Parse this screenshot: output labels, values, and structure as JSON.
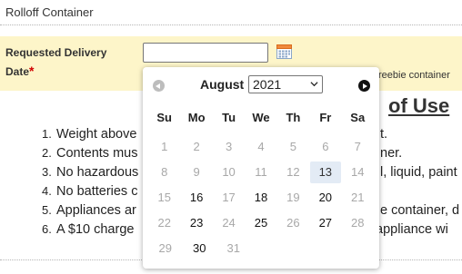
{
  "header": {
    "title": "Rolloff Container"
  },
  "delivery": {
    "label": "Requested Delivery Date",
    "required_mark": "*",
    "input_value": "",
    "side_note": "reebie container"
  },
  "terms": {
    "title": "of Use",
    "items": [
      {
        "num": "1.",
        "text": "Weight above",
        "tail": "t."
      },
      {
        "num": "2.",
        "text": "Contents mus",
        "tail": "ner."
      },
      {
        "num": "3.",
        "text": "No hazardous",
        "tail": "l, liquid, paint"
      },
      {
        "num": "4.",
        "text": "No batteries c",
        "tail": ""
      },
      {
        "num": "5.",
        "text": "Appliances ar",
        "tail": "e container, d"
      },
      {
        "num": "6.",
        "text": "A $10 charge",
        "tail": "appliance wi"
      }
    ]
  },
  "calendar": {
    "month": "August",
    "year": "2021",
    "days_of_week": [
      "Su",
      "Mo",
      "Tu",
      "We",
      "Th",
      "Fr",
      "Sa"
    ],
    "weeks": [
      [
        {
          "d": "1",
          "s": "dim"
        },
        {
          "d": "2",
          "s": "dim"
        },
        {
          "d": "3",
          "s": "dim"
        },
        {
          "d": "4",
          "s": "dim"
        },
        {
          "d": "5",
          "s": "dim"
        },
        {
          "d": "6",
          "s": "dim"
        },
        {
          "d": "7",
          "s": "dim"
        }
      ],
      [
        {
          "d": "8",
          "s": "dim"
        },
        {
          "d": "9",
          "s": "dim"
        },
        {
          "d": "10",
          "s": "dim"
        },
        {
          "d": "11",
          "s": "dim"
        },
        {
          "d": "12",
          "s": "dim"
        },
        {
          "d": "13",
          "s": "today"
        },
        {
          "d": "14",
          "s": "dim"
        }
      ],
      [
        {
          "d": "15",
          "s": "dim"
        },
        {
          "d": "16",
          "s": "on"
        },
        {
          "d": "17",
          "s": "dim"
        },
        {
          "d": "18",
          "s": "on"
        },
        {
          "d": "19",
          "s": "dim"
        },
        {
          "d": "20",
          "s": "on"
        },
        {
          "d": "21",
          "s": "dim"
        }
      ],
      [
        {
          "d": "22",
          "s": "dim"
        },
        {
          "d": "23",
          "s": "on"
        },
        {
          "d": "24",
          "s": "dim"
        },
        {
          "d": "25",
          "s": "on"
        },
        {
          "d": "26",
          "s": "dim"
        },
        {
          "d": "27",
          "s": "on"
        },
        {
          "d": "28",
          "s": "dim"
        }
      ],
      [
        {
          "d": "29",
          "s": "dim"
        },
        {
          "d": "30",
          "s": "on"
        },
        {
          "d": "31",
          "s": "dim"
        }
      ]
    ],
    "today_highlight_color": "#e3ebf5"
  },
  "icons": {
    "calendar": "calendar-icon",
    "prev": "prev-month-icon",
    "next": "next-month-icon"
  }
}
